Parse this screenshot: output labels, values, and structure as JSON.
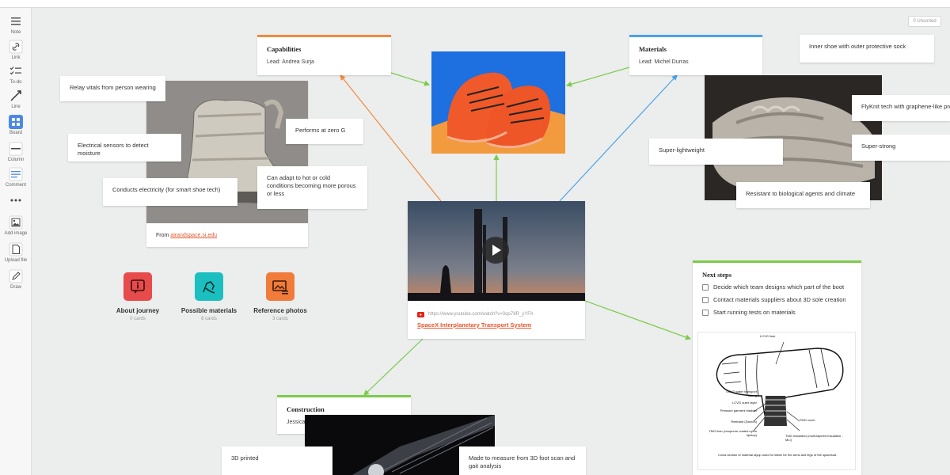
{
  "toolbar": {
    "items": [
      {
        "label": "Note",
        "icon": "note-icon"
      },
      {
        "label": "Link",
        "icon": "link-icon"
      },
      {
        "label": "To-do",
        "icon": "todo-icon"
      },
      {
        "label": "Line",
        "icon": "line-icon"
      },
      {
        "label": "Board",
        "icon": "board-icon"
      },
      {
        "label": "Column",
        "icon": "column-icon"
      },
      {
        "label": "Comment",
        "icon": "comment-icon"
      },
      {
        "label": "Add image",
        "icon": "add-image-icon"
      },
      {
        "label": "Upload file",
        "icon": "upload-file-icon"
      },
      {
        "label": "Draw",
        "icon": "draw-icon"
      }
    ]
  },
  "unsorted": {
    "count": "0",
    "label": "Unsorted"
  },
  "notes": {
    "relay_vitals": "Relay vitals from person wearing",
    "electrical_sensors": "Electrical sensors to detect moisture",
    "conducts_electricity": "Conducts electricity (for smart shoe tech)",
    "performs_zero_g": "Performs at zero G",
    "adapt_hot_cold": "Can adapt to hot or cold conditions becoming more porous or less",
    "inner_shoe": "Inner shoe with outer protective sock",
    "flyknit": "FlyKnit tech with graphene-like pro",
    "super_lightweight": "Super-lightweight",
    "super_strong": "Super-strong",
    "resistant": "Resistant to biological agents and climate",
    "printed_3d": "3D printed",
    "made_to_measure": "Made to measure from 3D foot scan and gait analysis"
  },
  "boot_photo": {
    "from_label": "From",
    "source_link": "airandspace.si.edu"
  },
  "capabilities": {
    "title": "Capabilities",
    "lead": "Lead: Andrea Surja",
    "color": "#f08a3c"
  },
  "materials": {
    "title": "Materials",
    "lead": "Lead: Michel Durras",
    "color": "#4aa3e8"
  },
  "construction": {
    "title": "Construction",
    "lead": "Jessica Robertson & Emil Sirence",
    "color": "#7ccc4c"
  },
  "video": {
    "url": "https://www.youtube.com/watch?v=0qo78R_yYFA",
    "title": "SpaceX Interplanetary Transport System"
  },
  "boards": [
    {
      "title": "About journey",
      "count": "0 cards",
      "color": "#e84b4b",
      "icon": "info-icon"
    },
    {
      "title": "Possible materials",
      "count": "8 cards",
      "color": "#1bbfbf",
      "icon": "pen-icon"
    },
    {
      "title": "Reference photos",
      "count": "3 cards",
      "color": "#f07b3a",
      "icon": "photos-icon"
    }
  ],
  "next_steps": {
    "title": "Next steps",
    "color": "#7ccc4c",
    "items": [
      "Decide which team designs which part of the boot",
      "Contact materials suppliers about 3D sole creation",
      "Start running tests on materials"
    ]
  },
  "diagram": {
    "labels": [
      "LCVG liner",
      "LCVG water transport tubing",
      "LCVG outer layer",
      "Pressure garment bladder",
      "Restraint (Dacron)",
      "TMG liner (neoprene coated nylon ripstop)",
      "TMG insulation (multi-layered insulation - MLI)",
      "TMG cover"
    ],
    "caption": "Cross section of material layup used for fabric for the arms and legs of the spacesuit."
  }
}
